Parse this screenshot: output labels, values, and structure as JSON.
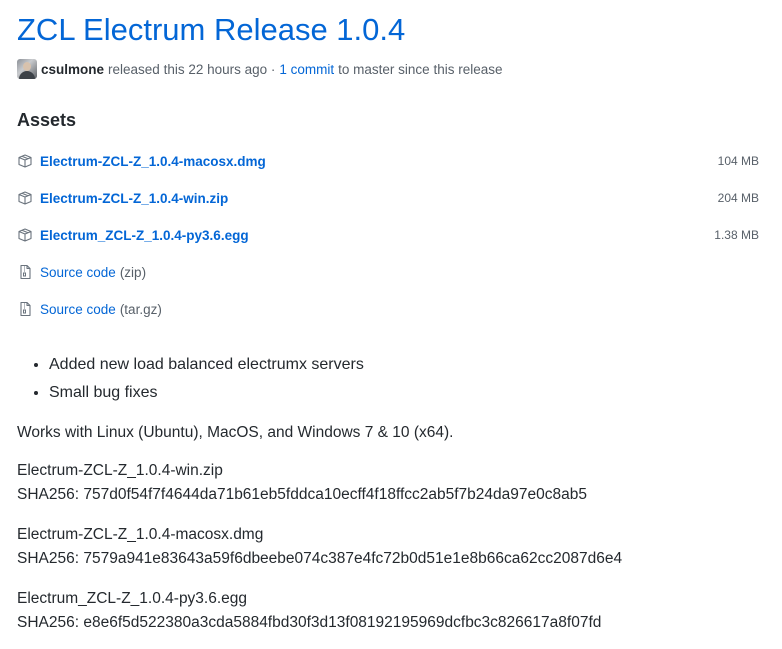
{
  "release": {
    "title": "ZCL Electrum Release 1.0.4",
    "author": "csulmone",
    "released_text": "released this 22 hours ago ·",
    "commit_link": "1 commit",
    "commit_suffix": "to master since this release"
  },
  "assets": {
    "heading": "Assets",
    "files": [
      {
        "name": "Electrum-ZCL-Z_1.0.4-macosx.dmg",
        "size": "104 MB",
        "icon": "package-icon"
      },
      {
        "name": "Electrum-ZCL-Z_1.0.4-win.zip",
        "size": "204 MB",
        "icon": "package-icon"
      },
      {
        "name": "Electrum_ZCL-Z_1.0.4-py3.6.egg",
        "size": "1.38 MB",
        "icon": "package-icon"
      }
    ],
    "source": [
      {
        "label": "Source code",
        "format": "(zip)",
        "icon": "file-zip-icon"
      },
      {
        "label": "Source code",
        "format": "(tar.gz)",
        "icon": "file-zip-icon"
      }
    ]
  },
  "notes": {
    "bullets": [
      "Added new load balanced electrumx servers",
      "Small bug fixes"
    ],
    "compatibility": "Works with Linux (Ubuntu), MacOS, and Windows 7 & 10 (x64).",
    "checksums": [
      {
        "file": "Electrum-ZCL-Z_1.0.4-win.zip",
        "sha": "SHA256: 757d0f54f7f4644da71b61eb5fddca10ecff4f18ffcc2ab5f7b24da97e0c8ab5"
      },
      {
        "file": "Electrum-ZCL-Z_1.0.4-macosx.dmg",
        "sha": "SHA256: 7579a941e83643a59f6dbeebe074c387e4fc72b0d51e1e8b66ca62cc2087d6e4"
      },
      {
        "file": "Electrum_ZCL-Z_1.0.4-py3.6.egg",
        "sha": "SHA256: e8e6f5d522380a3cda5884fbd30f3d13f08192195969dcfbc3c826617a8f07fd"
      }
    ]
  },
  "colors": {
    "link": "#0366d6",
    "text": "#24292e",
    "muted": "#586069"
  }
}
